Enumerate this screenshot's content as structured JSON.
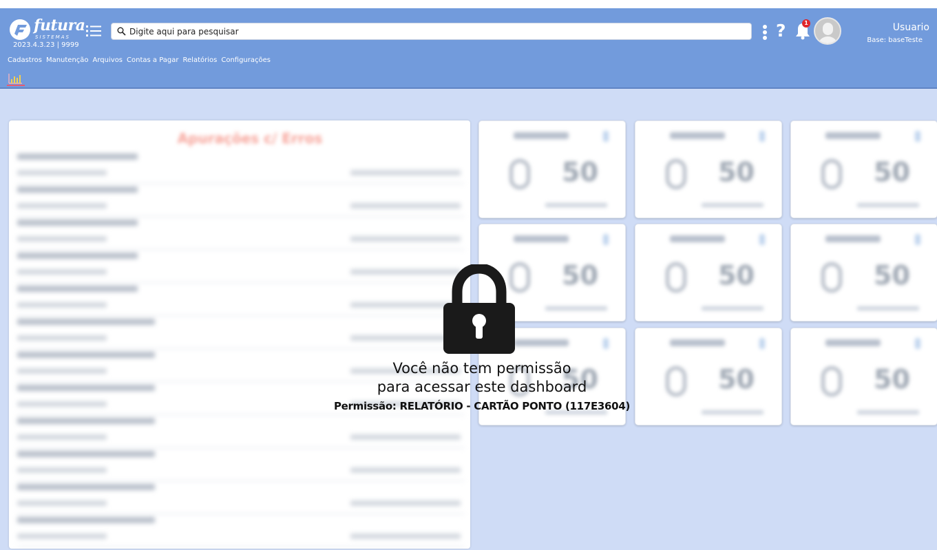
{
  "app": {
    "logo_text": "futura",
    "logo_subtext": "SISTEMAS",
    "version": "2023.4.3.23 | 9999"
  },
  "search": {
    "placeholder": "Digite aqui para pesquisar"
  },
  "notifications": {
    "count": "1"
  },
  "user": {
    "name": "Usuario",
    "base": "Base: baseTeste"
  },
  "nav": {
    "items": [
      "Cadastros",
      "Manutenção",
      "Arquivos",
      "Contas a Pagar",
      "Relatórios",
      "Configurações"
    ]
  },
  "dashboard": {
    "left_panel_title": "Apurações c/ Erros",
    "card_value": "50",
    "locked_message_line1": "Você não tem permissão",
    "locked_message_line2": "para acessar este dashboard",
    "permission": "Permissão: RELATÓRIO - CARTÃO PONTO (117E3604)"
  },
  "colors": {
    "header_bg": "#729bdc",
    "page_bg": "#cfdcf6",
    "badge": "#e0262b",
    "tab_underline": "#e85a71"
  },
  "icons": [
    "menu-icon",
    "search-icon",
    "kebab-icon",
    "help-icon",
    "bell-icon",
    "avatar",
    "chart-icon",
    "lock-icon"
  ]
}
